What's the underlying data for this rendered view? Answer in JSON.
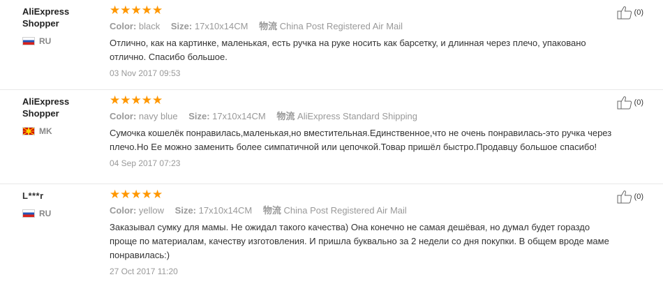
{
  "labels": {
    "color": "Color:",
    "size": "Size:",
    "shipping": "物流"
  },
  "colors": {
    "star": "#ff9700",
    "meta": "#999999"
  },
  "reviews": [
    {
      "user": "AliExpress Shopper",
      "user_line1": "AliExpress",
      "user_line2": "Shopper",
      "country": "RU",
      "flag": "russia-flag",
      "stars": "★★★★★",
      "rating": 5,
      "color": "black",
      "size": "17x10x14CM",
      "shipping": "China Post Registered Air Mail",
      "text": "Отлично, как на картинке, маленькая, есть ручка на руке носить как барсетку, и длинная через плечо, упаковано отлично. Спасибо большое.",
      "date": "03 Nov 2017 09:53",
      "likes": "(0)"
    },
    {
      "user": "AliExpress Shopper",
      "user_line1": "AliExpress",
      "user_line2": "Shopper",
      "country": "MK",
      "flag": "macedonia-flag",
      "stars": "★★★★★",
      "rating": 5,
      "color": "navy blue",
      "size": "17x10x14CM",
      "shipping": "AliExpress Standard Shipping",
      "text": "Сумочка кошелёк понравилась,маленькая,но вместительная.Единственное,что не очень понравилась-это ручка через плечо.Но Ее можно заменить более симпатичной или цепочкой.Товар пришёл быстро.Продавцу большое спасибо!",
      "date": "04 Sep 2017 07:23",
      "likes": "(0)"
    },
    {
      "user": "L***r",
      "country": "RU",
      "flag": "russia-flag",
      "stars": "★★★★★",
      "rating": 5,
      "color": "yellow",
      "size": "17x10x14CM",
      "shipping": "China Post Registered Air Mail",
      "text": "Заказывал сумку для мамы. Не ожидал такого качества) Она конечно не самая дешёвая, но думал будет гораздо проще по материалам, качеству изготовления. И пришла буквально за 2 недели со дня покупки. В общем вроде маме понравилась:)",
      "date": "27 Oct 2017 11:20",
      "likes": "(0)"
    }
  ]
}
